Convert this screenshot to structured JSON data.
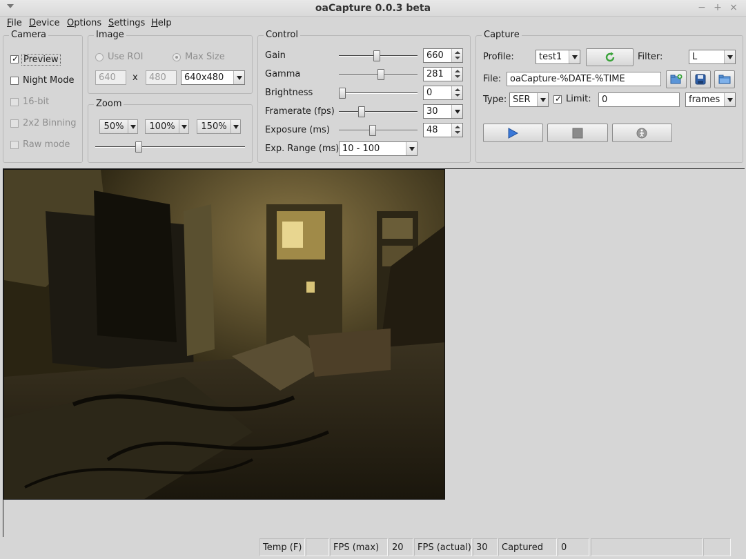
{
  "window": {
    "title": "oaCapture 0.0.3 beta",
    "minimize_glyph": "−",
    "maximize_glyph": "+",
    "close_glyph": "×"
  },
  "menu": {
    "file": {
      "u": "F",
      "rest": "ile"
    },
    "device": {
      "u": "D",
      "rest": "evice"
    },
    "options": {
      "u": "O",
      "rest": "ptions"
    },
    "settings": {
      "u": "S",
      "rest": "ettings"
    },
    "help": {
      "u": "H",
      "rest": "elp"
    }
  },
  "camera": {
    "title": "Camera",
    "preview": {
      "label": "Preview",
      "checked": true
    },
    "night_mode": {
      "label": "Night Mode",
      "checked": false
    },
    "bit16": {
      "label": "16-bit",
      "checked": false
    },
    "binning": {
      "label": "2x2 Binning",
      "checked": false
    },
    "raw_mode": {
      "label": "Raw mode",
      "checked": false
    },
    "check_glyph": "✓"
  },
  "image": {
    "title": "Image",
    "use_roi": "Use ROI",
    "max_size": "Max Size",
    "width": "640",
    "x_label": "x",
    "height": "480",
    "resolution": "640x480"
  },
  "zoom": {
    "title": "Zoom",
    "buttons": [
      "50%",
      "100%",
      "150%"
    ],
    "slider_level": 0.28
  },
  "control": {
    "title": "Control",
    "gain": {
      "label": "Gain",
      "value": "660",
      "level": 0.48
    },
    "gamma": {
      "label": "Gamma",
      "value": "281",
      "level": 0.54
    },
    "brightness": {
      "label": "Brightness",
      "value": "0",
      "level": 0.0
    },
    "framerate": {
      "label": "Framerate (fps)",
      "value": "30",
      "level": 0.27
    },
    "exposure": {
      "label": "Exposure (ms)",
      "value": "48",
      "level": 0.42
    },
    "exp_range": {
      "label": "Exp. Range (ms)",
      "value": "10 - 100"
    }
  },
  "capture": {
    "title": "Capture",
    "profile_label": "Profile:",
    "profile": "test1",
    "filter_label": "Filter:",
    "filter": "L",
    "file_label": "File:",
    "file": "oaCapture-%DATE-%TIME",
    "type_label": "Type:",
    "type": "SER",
    "limit_label": "Limit:",
    "limit_checked": true,
    "limit_value": "0",
    "limit_unit": "frames"
  },
  "status": {
    "temp_label": "Temp (F)",
    "temp_value": "",
    "fps_max_label": "FPS (max)",
    "fps_max_value": "20",
    "fps_actual_label": "FPS (actual)",
    "fps_actual_value": "30",
    "captured_label": "Captured",
    "captured_value": "0"
  },
  "colors": {
    "accent_blue": "#3a78d8",
    "refresh_green": "#3aa33a"
  }
}
